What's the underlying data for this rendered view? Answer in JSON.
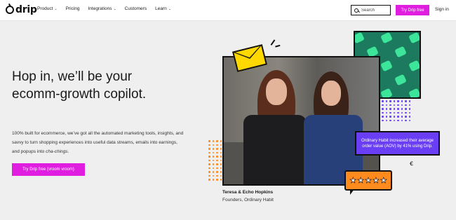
{
  "nav": {
    "logo_text": "drip",
    "links": [
      {
        "label": "Product",
        "has_dropdown": true
      },
      {
        "label": "Pricing",
        "has_dropdown": false
      },
      {
        "label": "Integrations",
        "has_dropdown": true
      },
      {
        "label": "Customers",
        "has_dropdown": false
      },
      {
        "label": "Learn",
        "has_dropdown": true
      }
    ],
    "search_placeholder": "Search",
    "cta_label": "Try Drip free",
    "signin_label": "Sign in"
  },
  "hero": {
    "title": "Hop in, we’ll be your ecomm-growth copilot.",
    "body_main": "100% built for ecommerce, we’ve got all the automated marketing tools, insights, and savvy to turn shopping experiences into useful data streams, emails into earnings, and popups into ",
    "body_emphasis": "cha-chings",
    "body_end": ".",
    "cta_label": "Try Drip free (vroom vroom)"
  },
  "testimonial": {
    "stat_text": "Ordinary Habit increased their average order value (AOV) by 41% using Drip.",
    "rating_stars": 5,
    "name": "Teresa & Echo Hopkins",
    "role": "Founders, Ordinary Habit"
  },
  "colors": {
    "accent": "#e01ee0",
    "stat_purple": "#6a3ef5",
    "star_orange": "#ff8a1e",
    "envelope_yellow": "#ffd800",
    "puzzle_green": "#1c7a5e",
    "puzzle_mint": "#3ce59a",
    "background": "#f0efef"
  },
  "icons": {
    "search": "search-icon",
    "chevron": "chevron-down-icon",
    "star": "star-icon",
    "envelope": "envelope-icon"
  }
}
